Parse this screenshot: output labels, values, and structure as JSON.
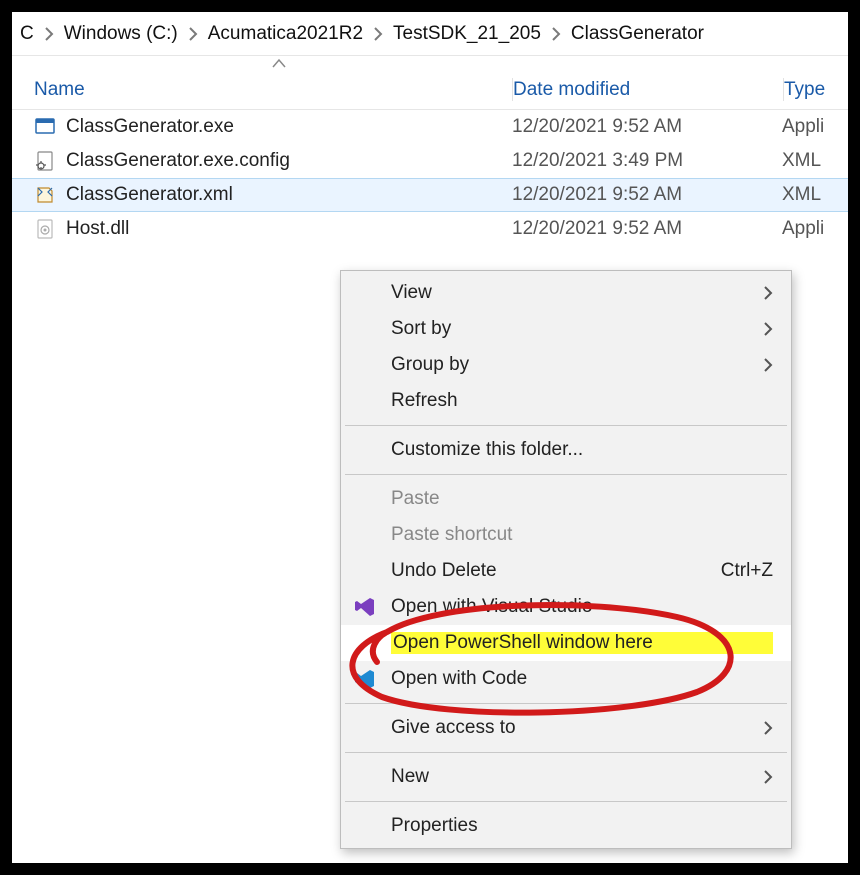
{
  "breadcrumb": {
    "root": "C",
    "items": [
      "Windows (C:)",
      "Acumatica2021R2",
      "TestSDK_21_205",
      "ClassGenerator"
    ]
  },
  "columns": {
    "name": "Name",
    "date": "Date modified",
    "type": "Type"
  },
  "files": [
    {
      "name": "ClassGenerator.exe",
      "date": "12/20/2021 9:52 AM",
      "type": "Appli",
      "icon": "exe",
      "selected": false
    },
    {
      "name": "ClassGenerator.exe.config",
      "date": "12/20/2021 3:49 PM",
      "type": "XML",
      "icon": "config",
      "selected": false
    },
    {
      "name": "ClassGenerator.xml",
      "date": "12/20/2021 9:52 AM",
      "type": "XML",
      "icon": "xml",
      "selected": true
    },
    {
      "name": "Host.dll",
      "date": "12/20/2021 9:52 AM",
      "type": "Appli",
      "icon": "dll",
      "selected": false
    }
  ],
  "context_menu": {
    "items": [
      {
        "label": "View",
        "submenu": true
      },
      {
        "label": "Sort by",
        "submenu": true
      },
      {
        "label": "Group by",
        "submenu": true
      },
      {
        "label": "Refresh"
      },
      {
        "sep": true
      },
      {
        "label": "Customize this folder..."
      },
      {
        "sep": true
      },
      {
        "label": "Paste",
        "disabled": true
      },
      {
        "label": "Paste shortcut",
        "disabled": true
      },
      {
        "label": "Undo Delete",
        "shortcut": "Ctrl+Z"
      },
      {
        "label": "Open with Visual Studio",
        "icon": "vs"
      },
      {
        "label": "Open PowerShell window here",
        "highlight": true,
        "hover": true
      },
      {
        "label": "Open with Code",
        "icon": "vscode"
      },
      {
        "sep": true
      },
      {
        "label": "Give access to",
        "submenu": true
      },
      {
        "sep": true
      },
      {
        "label": "New",
        "submenu": true
      },
      {
        "sep": true
      },
      {
        "label": "Properties"
      }
    ]
  }
}
